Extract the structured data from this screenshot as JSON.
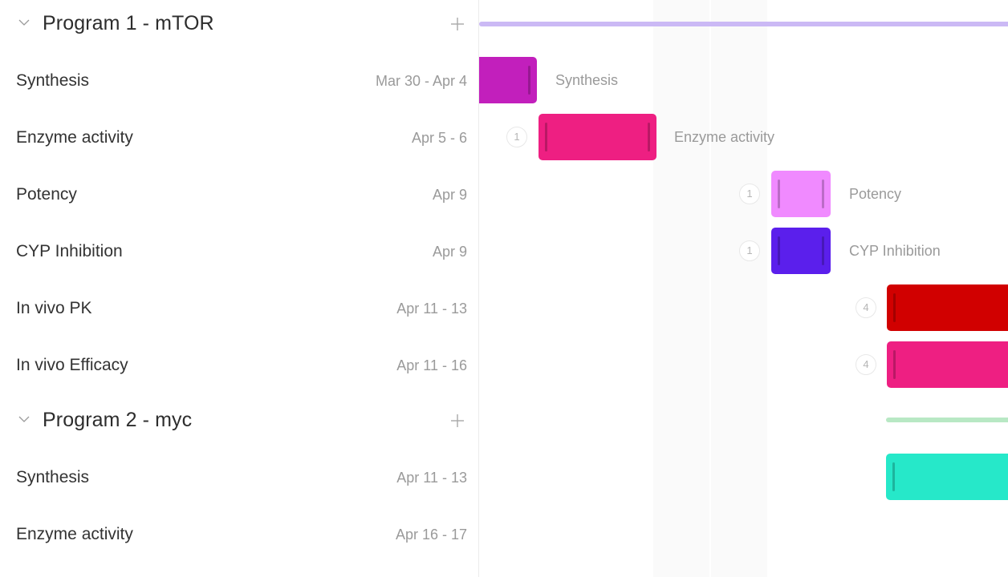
{
  "groups": [
    {
      "title": "Program 1 - mTOR",
      "summary_color": "#cbb9f5",
      "tasks": [
        {
          "name": "Synthesis",
          "dates": "Mar 30 - Apr 4",
          "color": "#c21fbc",
          "deps": null
        },
        {
          "name": "Enzyme activity",
          "dates": "Apr 5 - 6",
          "color": "#ee1f82",
          "deps": "1"
        },
        {
          "name": "Potency",
          "dates": "Apr 9",
          "color": "#f08aff",
          "deps": "1"
        },
        {
          "name": "CYP Inhibition",
          "dates": "Apr 9",
          "color": "#5b1fec",
          "deps": "1"
        },
        {
          "name": "In vivo PK",
          "dates": "Apr 11 - 13",
          "color": "#d10000",
          "deps": "4"
        },
        {
          "name": "In vivo Efficacy",
          "dates": "Apr 11 - 16",
          "color": "#ee1f82",
          "deps": "4"
        }
      ]
    },
    {
      "title": "Program 2 - myc",
      "summary_color": "#b8e8c4",
      "tasks": [
        {
          "name": "Synthesis",
          "dates": "Apr 11 - 13",
          "color": "#26e8c9",
          "deps": null
        },
        {
          "name": "Enzyme activity",
          "dates": "Apr 16 - 17",
          "color": null,
          "deps": null
        }
      ]
    }
  ],
  "icons": {
    "collapse": "chevron-down-icon",
    "add": "plus-icon"
  }
}
